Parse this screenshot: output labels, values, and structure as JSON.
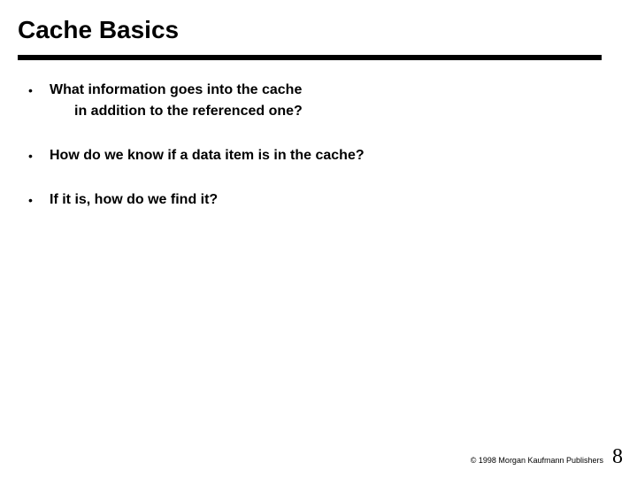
{
  "title": "Cache Basics",
  "bullets": [
    {
      "line1": "What information goes into the cache",
      "line2": "in addition to the referenced one?"
    },
    {
      "line1": "How do we know if a data item is in the cache?"
    },
    {
      "line1": "If it is, how do we find it?"
    }
  ],
  "footer": {
    "copyright": "© 1998 Morgan Kaufmann Publishers",
    "page": "8"
  }
}
